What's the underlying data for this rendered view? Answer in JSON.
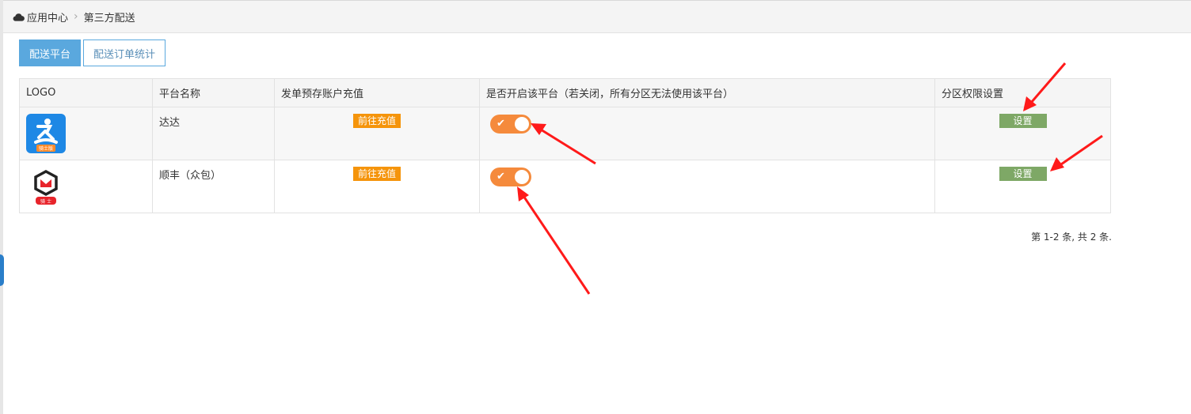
{
  "breadcrumb": {
    "icon": "cloud-icon",
    "root": "应用中心",
    "separator": "›",
    "current": "第三方配送"
  },
  "tabs": [
    {
      "label": "配送平台",
      "active": true
    },
    {
      "label": "配送订单统计",
      "active": false
    }
  ],
  "table": {
    "headers": [
      "LOGO",
      "平台名称",
      "发单预存账户充值",
      "是否开启该平台（若关闭，所有分区无法使用该平台）",
      "分区权限设置"
    ],
    "rows": [
      {
        "logo": "dada-logo",
        "logo_text": "骑士版",
        "name": "达达",
        "recharge_label": "前往充值",
        "enabled": true,
        "check": "✔",
        "setting_label": "设置"
      },
      {
        "logo": "shunfeng-logo",
        "logo_text": "骑 士",
        "name": "顺丰（众包）",
        "recharge_label": "前往充值",
        "enabled": true,
        "check": "✔",
        "setting_label": "设置"
      }
    ]
  },
  "pager": {
    "text": "第 1-2 条, 共 2 条."
  },
  "colors": {
    "tab_active": "#5aa8de",
    "recharge": "#f5940b",
    "toggle_on": "#f58a3c",
    "setting": "#7ea866",
    "annotation_arrow": "#ff1a1a"
  }
}
